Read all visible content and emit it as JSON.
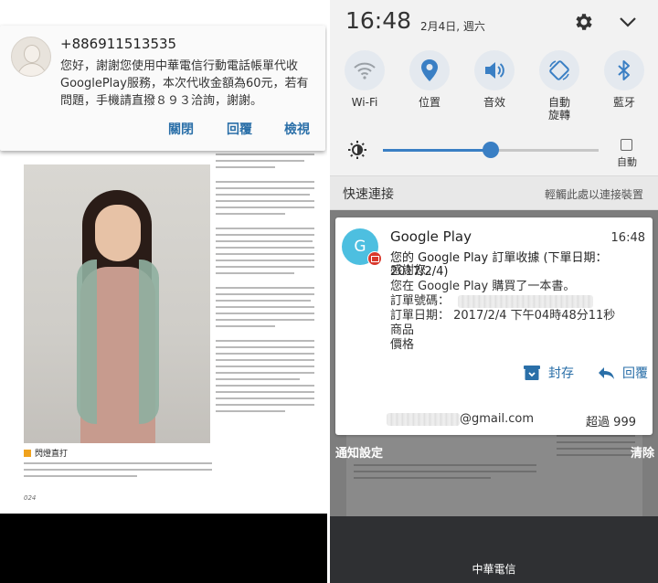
{
  "left": {
    "notification": {
      "sender": "+886911513535",
      "message": "您好，謝謝您使用中華電信行動電話帳單代收GooglePlay服務，本次代收金額為60元，若有問題，手機請直撥８９３洽詢，謝謝。",
      "actions": [
        "關閉",
        "回覆",
        "檢視"
      ]
    },
    "book": {
      "caption": "閃燈直打",
      "page_number": "024"
    }
  },
  "right": {
    "status": {
      "time": "16:48",
      "date": "2月4日, 週六"
    },
    "quick_settings": [
      {
        "label": "Wi-Fi",
        "icon": "wifi-icon"
      },
      {
        "label": "位置",
        "icon": "location-icon"
      },
      {
        "label": "音效",
        "icon": "sound-icon"
      },
      {
        "label": "自動\n旋轉",
        "icon": "auto-rotate-icon"
      },
      {
        "label": "藍牙",
        "icon": "bluetooth-icon"
      }
    ],
    "brightness": {
      "level": 0.5,
      "auto_label": "自動"
    },
    "quick_connect": {
      "title": "快速連接",
      "hint": "輕觸此處以連接裝置"
    },
    "notification": {
      "avatar_letter": "G",
      "app": "Google Play",
      "time": "16:48",
      "title": "您的 Google Play 訂單收據 (下單日期：2017/2/4)",
      "line1": "感謝您。",
      "line2": "您在 Google Play 購買了一本書。",
      "order_no_label": "訂單號碼：",
      "order_date": "訂單日期： 2017/2/4 下午04時48分11秒",
      "line_product": "商品",
      "line_price": "價格",
      "archive_label": "封存",
      "reply_label": "回覆",
      "email": "@gmail.com",
      "count": "超過 999"
    },
    "footer": {
      "settings": "通知設定",
      "clear": "清除",
      "carrier": "中華電信"
    }
  },
  "colors": {
    "accent": "#3a7fc4",
    "link": "#2a6fa8",
    "google_play": "#4dbfe0",
    "gmail": "#d9382c"
  }
}
